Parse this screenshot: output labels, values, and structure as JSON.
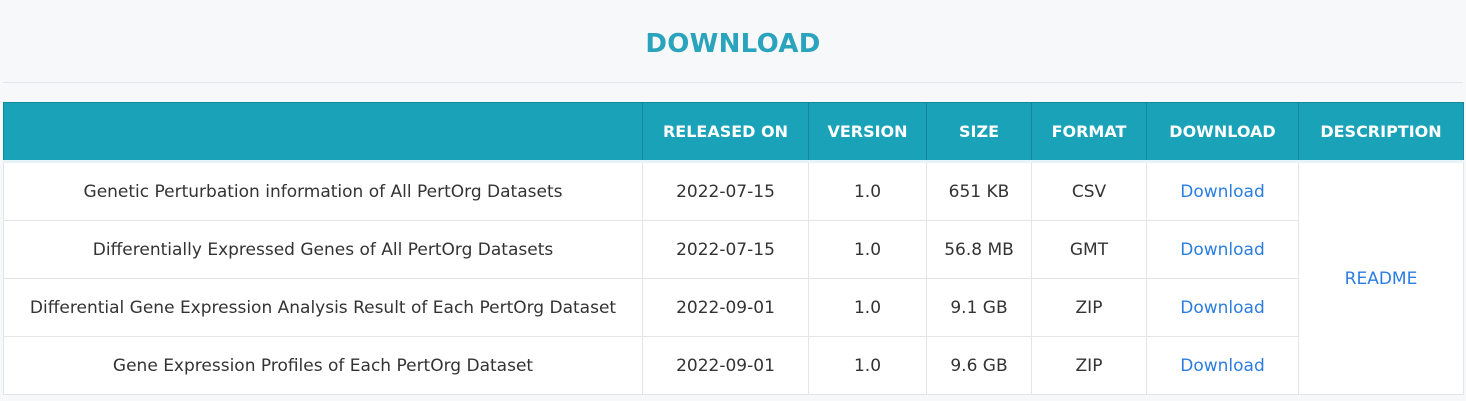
{
  "header": {
    "title": "DOWNLOAD"
  },
  "table": {
    "columns": [
      "",
      "RELEASED ON",
      "VERSION",
      "SIZE",
      "FORMAT",
      "DOWNLOAD",
      "DESCRIPTION"
    ],
    "rows": [
      {
        "name": "Genetic Perturbation information of All PertOrg Datasets",
        "released": "2022-07-15",
        "version": "1.0",
        "size": "651 KB",
        "format": "CSV",
        "download": "Download"
      },
      {
        "name": "Differentially Expressed Genes of All PertOrg Datasets",
        "released": "2022-07-15",
        "version": "1.0",
        "size": "56.8 MB",
        "format": "GMT",
        "download": "Download"
      },
      {
        "name": "Differential Gene Expression Analysis Result of Each PertOrg Dataset",
        "released": "2022-09-01",
        "version": "1.0",
        "size": "9.1 GB",
        "format": "ZIP",
        "download": "Download"
      },
      {
        "name": "Gene Expression Profiles of Each PertOrg Dataset",
        "released": "2022-09-01",
        "version": "1.0",
        "size": "9.6 GB",
        "format": "ZIP",
        "download": "Download"
      }
    ],
    "description_link": "README"
  },
  "colors": {
    "title": "#2aa3bc",
    "header_bg": "#19a2b8",
    "link": "#2b7de0"
  }
}
